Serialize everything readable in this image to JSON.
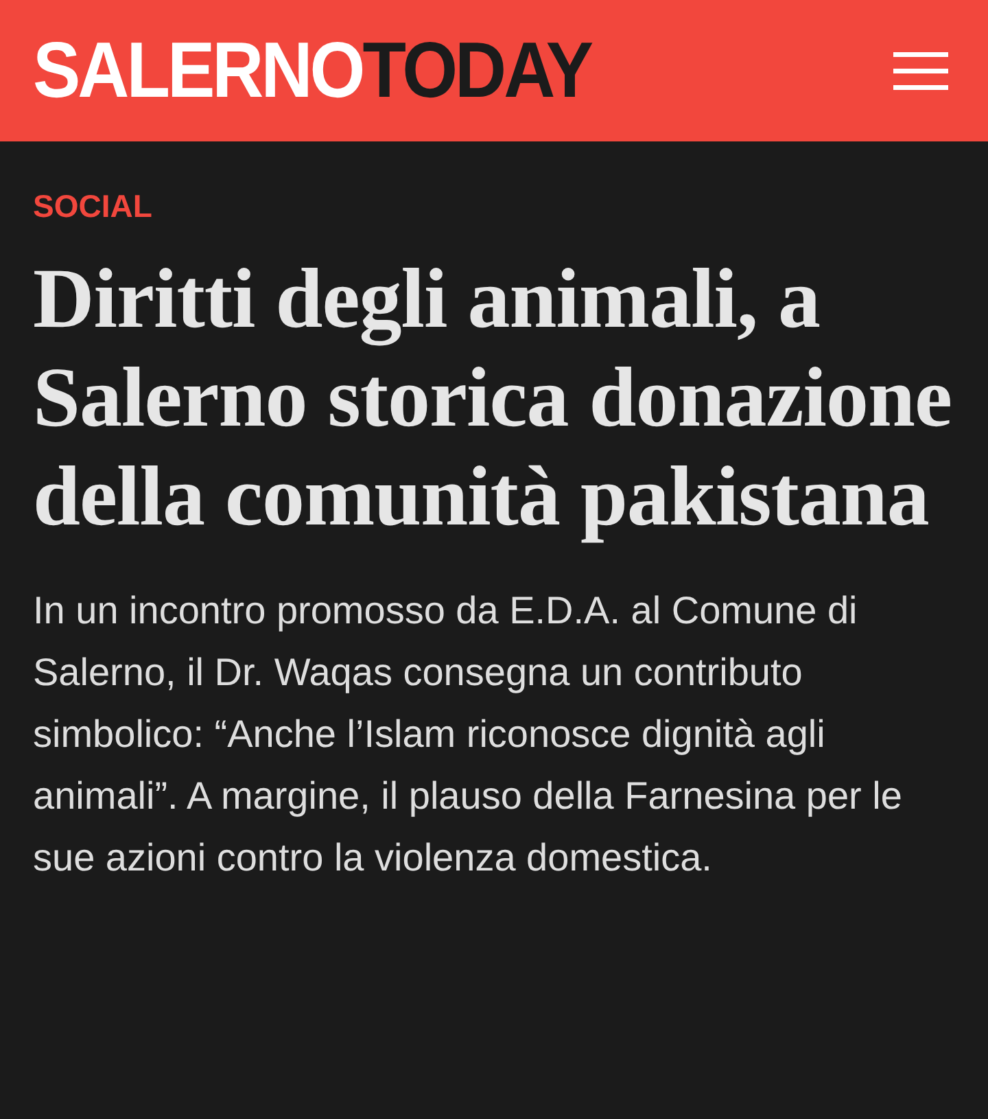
{
  "header": {
    "logo_primary": "SALERNO",
    "logo_secondary": "TODAY"
  },
  "article": {
    "category": "SOCIAL",
    "title": "Diritti degli animali, a Salerno storica donazione della comunità pakistana",
    "summary": "In un incontro promosso da E.D.A. al Comune di Salerno, il Dr. Waqas consegna un contributo simbolico: “Anche l’Islam riconosce dignità agli animali”. A margine, il plauso della Farnesina per le sue azioni contro la violenza domestica."
  }
}
